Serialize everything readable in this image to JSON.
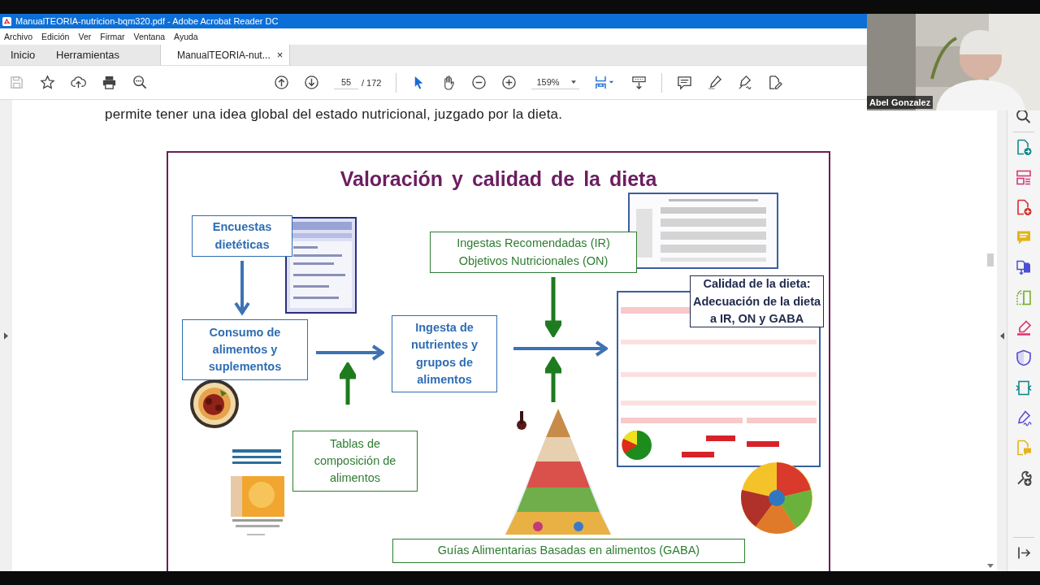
{
  "window": {
    "title": "ManualTEORIA-nutricion-bqm320.pdf - Adobe Acrobat Reader DC"
  },
  "menu": [
    "Archivo",
    "Edición",
    "Ver",
    "Firmar",
    "Ventana",
    "Ayuda"
  ],
  "tabs": [
    {
      "label": "Inicio",
      "selected": false
    },
    {
      "label": "Herramientas",
      "selected": false
    },
    {
      "label": "ManualTEORIA-nut...",
      "selected": true,
      "close": "×"
    }
  ],
  "toolbar": {
    "page": "55",
    "page_total": "/ 172",
    "zoom": "159%"
  },
  "document": {
    "paragraph": "permite tener una idea global del estado nutricional, juzgado por la dieta.",
    "slide": {
      "title": "Valoración y calidad de la dieta",
      "boxes": [
        {
          "lines": [
            "Encuestas",
            "dietéticas"
          ],
          "color": "#2f6db3",
          "bold": true
        },
        {
          "lines": [
            "Consumo de",
            "alimentos y",
            "suplementos"
          ],
          "color": "#2f6db3",
          "bold": true
        },
        {
          "lines": [
            "Ingesta de",
            "nutrientes y",
            "grupos de",
            "alimentos"
          ],
          "color": "#2f6db3",
          "bold": true
        },
        {
          "lines": [
            "Tablas de",
            "composición de",
            "alimentos"
          ],
          "color": "#2e7d32",
          "bold": false
        },
        {
          "lines": [
            "Ingestas Recomendadas (IR)",
            "Objetivos Nutricionales (ON)"
          ],
          "color": "#2e7d32",
          "bold": false
        },
        {
          "lines": [
            "Calidad de la dieta:",
            "Adecuación de la dieta",
            "a IR, ON y GABA"
          ],
          "color": "#1f2a4d",
          "bold": true
        },
        {
          "lines": [
            "Guías Alimentarias Basadas en alimentos (GABA)"
          ],
          "color": "#2e7d32",
          "bold": false
        }
      ]
    }
  },
  "video": {
    "name": "Abel Gonzalez"
  }
}
